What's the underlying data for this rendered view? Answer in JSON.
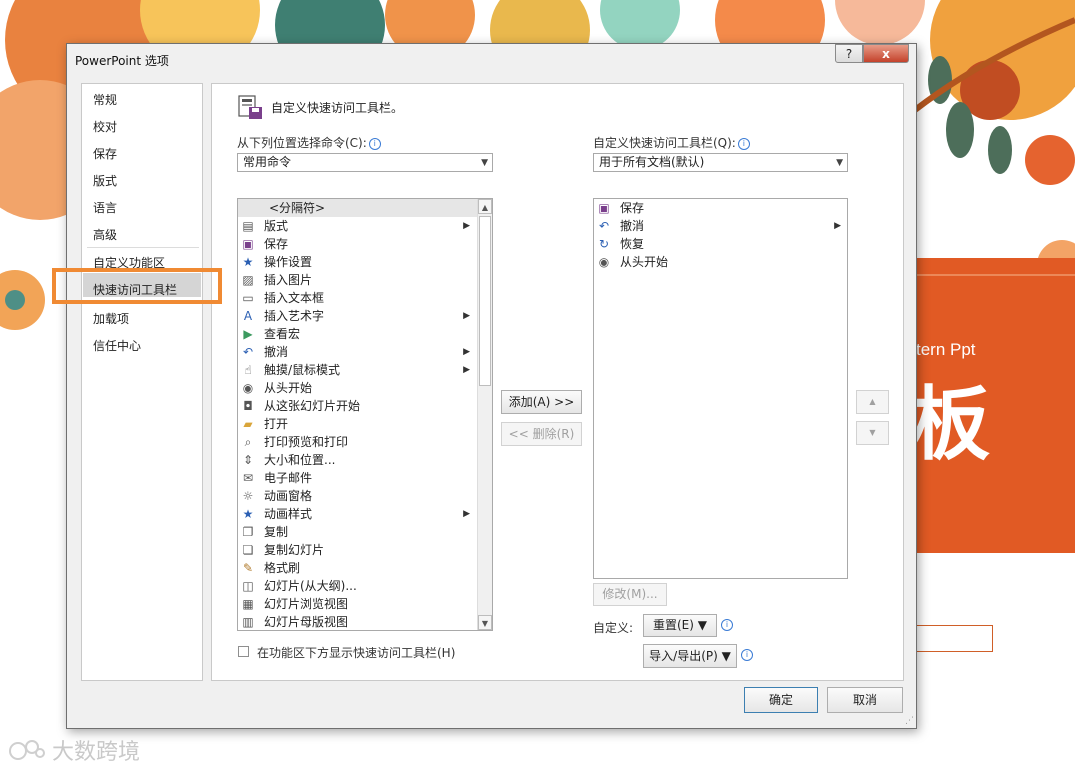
{
  "background": {
    "slide_subtitle": "tern Ppt",
    "slide_big_text": "板",
    "watermark": "大数跨境",
    "accent_orange": "#e15a24"
  },
  "dialog": {
    "title": "PowerPoint 选项",
    "help_label": "?",
    "close_label": "x"
  },
  "nav": {
    "items": [
      "常规",
      "校对",
      "保存",
      "版式",
      "语言",
      "高级",
      "自定义功能区",
      "快速访问工具栏",
      "加载项",
      "信任中心"
    ],
    "selected": "快速访问工具栏"
  },
  "panel": {
    "heading": "自定义快速访问工具栏。",
    "choose_label": "从下列位置选择命令(C):",
    "choose_value": "常用命令",
    "customize_label": "自定义快速访问工具栏(Q):",
    "customize_value": "用于所有文档(默认)",
    "info_glyph": "i"
  },
  "commands": [
    {
      "label": "<分隔符>",
      "icon": "none",
      "submenu": false
    },
    {
      "label": "版式",
      "icon": "layout-icon",
      "submenu": true
    },
    {
      "label": "保存",
      "icon": "save-icon",
      "submenu": false
    },
    {
      "label": "操作设置",
      "icon": "action-settings-icon",
      "submenu": false
    },
    {
      "label": "插入图片",
      "icon": "insert-picture-icon",
      "submenu": false
    },
    {
      "label": "插入文本框",
      "icon": "insert-textbox-icon",
      "submenu": false
    },
    {
      "label": "插入艺术字",
      "icon": "wordart-icon",
      "submenu": true
    },
    {
      "label": "查看宏",
      "icon": "macro-icon",
      "submenu": false
    },
    {
      "label": "撤消",
      "icon": "undo-icon",
      "submenu": true
    },
    {
      "label": "触摸/鼠标模式",
      "icon": "touch-mode-icon",
      "submenu": true
    },
    {
      "label": "从头开始",
      "icon": "start-from-beginning-icon",
      "submenu": false
    },
    {
      "label": "从这张幻灯片开始",
      "icon": "start-from-current-icon",
      "submenu": false
    },
    {
      "label": "打开",
      "icon": "open-folder-icon",
      "submenu": false
    },
    {
      "label": "打印预览和打印",
      "icon": "print-preview-icon",
      "submenu": false
    },
    {
      "label": "大小和位置...",
      "icon": "size-position-icon",
      "submenu": false
    },
    {
      "label": "电子邮件",
      "icon": "email-icon",
      "submenu": false
    },
    {
      "label": "动画窗格",
      "icon": "animation-pane-icon",
      "submenu": false
    },
    {
      "label": "动画样式",
      "icon": "animation-style-icon",
      "submenu": true
    },
    {
      "label": "复制",
      "icon": "copy-icon",
      "submenu": false
    },
    {
      "label": "复制幻灯片",
      "icon": "duplicate-slide-icon",
      "submenu": false
    },
    {
      "label": "格式刷",
      "icon": "format-painter-icon",
      "submenu": false
    },
    {
      "label": "幻灯片(从大纲)...",
      "icon": "slides-from-outline-icon",
      "submenu": false
    },
    {
      "label": "幻灯片浏览视图",
      "icon": "slide-sorter-icon",
      "submenu": false
    },
    {
      "label": "幻灯片母版视图",
      "icon": "slide-master-icon",
      "submenu": false
    }
  ],
  "toolbar_items": [
    {
      "label": "保存",
      "icon": "save-icon",
      "submenu": false
    },
    {
      "label": "撤消",
      "icon": "undo-icon",
      "submenu": true
    },
    {
      "label": "恢复",
      "icon": "redo-icon",
      "submenu": false
    },
    {
      "label": "从头开始",
      "icon": "start-from-beginning-icon",
      "submenu": false
    }
  ],
  "buttons": {
    "add": "添加(A) >>",
    "remove": "<< 删除(R)",
    "modify": "修改(M)...",
    "customize_label": "自定义:",
    "reset": "重置(E) ▼",
    "import_export": "导入/导出(P) ▼",
    "ok": "确定",
    "cancel": "取消",
    "move_up": "▲",
    "move_down": "▼"
  },
  "checkbox": {
    "label": "在功能区下方显示快速访问工具栏(H)",
    "checked": false
  },
  "glyphs": {
    "dropdown": "▼",
    "submenu": "▶",
    "scroll_up": "▲",
    "scroll_down": "▼",
    "grip": "⋰"
  }
}
